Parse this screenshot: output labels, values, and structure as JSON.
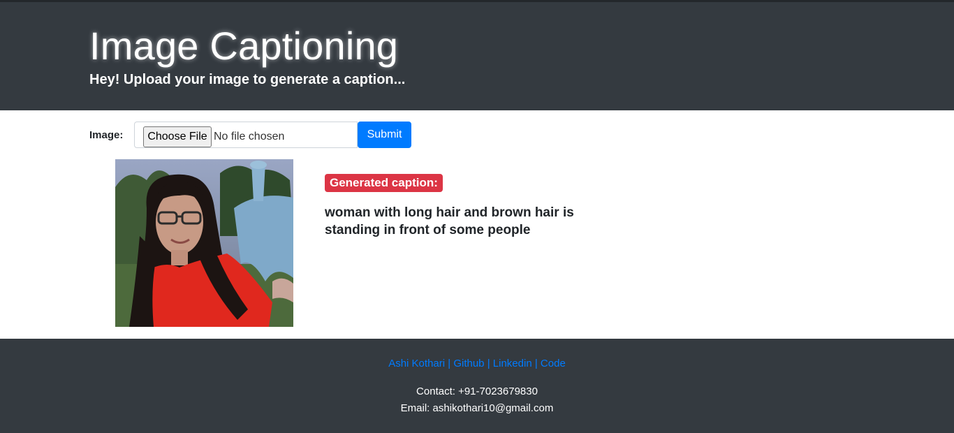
{
  "header": {
    "title": "Image Captioning",
    "subtitle": "Hey! Upload your image to generate a caption..."
  },
  "form": {
    "label": "Image:",
    "choose_file_label": "Choose File",
    "no_file_text": "No file chosen",
    "submit_label": "Submit"
  },
  "result": {
    "badge": "Generated caption:",
    "caption": "woman with long hair and brown hair is standing in front of some people"
  },
  "footer": {
    "links": [
      {
        "label": "Ashi Kothari"
      },
      {
        "label": "Github"
      },
      {
        "label": "Linkedin"
      },
      {
        "label": "Code"
      }
    ],
    "separator": "|",
    "contact": "Contact: +91-7023679830",
    "email": "Email: ashikothari10@gmail.com"
  },
  "colors": {
    "header_bg": "#343a40",
    "primary": "#007bff",
    "badge_red": "#dc3545",
    "footer_bg": "#343a40"
  }
}
